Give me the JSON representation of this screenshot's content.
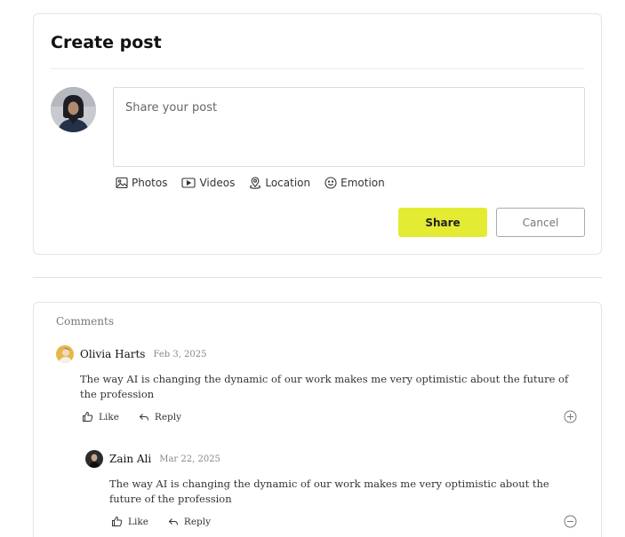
{
  "create_post": {
    "title": "Create post",
    "input_placeholder": "Share your post",
    "attachments": [
      {
        "label": "Photos",
        "icon": "image-icon"
      },
      {
        "label": "Videos",
        "icon": "video-icon"
      },
      {
        "label": "Location",
        "icon": "location-pin-icon"
      },
      {
        "label": "Emotion",
        "icon": "smiley-icon"
      }
    ],
    "share_label": "Share",
    "cancel_label": "Cancel"
  },
  "comments": {
    "title": "Comments",
    "items": [
      {
        "author": "Olivia Harts",
        "date": "Feb 3, 2025",
        "text": "The way AI is changing the dynamic of our work makes me very optimistic about the future of the profession",
        "like_label": "Like",
        "reply_label": "Reply",
        "toggle_icon": "plus-circle-icon"
      },
      {
        "author": "Zain Ali",
        "date": "Mar 22, 2025",
        "text": "The way AI is changing the dynamic of our work makes me very optimistic about the future of the profession",
        "like_label": "Like",
        "reply_label": "Reply",
        "toggle_icon": "minus-circle-icon"
      }
    ]
  },
  "colors": {
    "share_button": "#e4eb33",
    "border": "#e4e4e4"
  }
}
